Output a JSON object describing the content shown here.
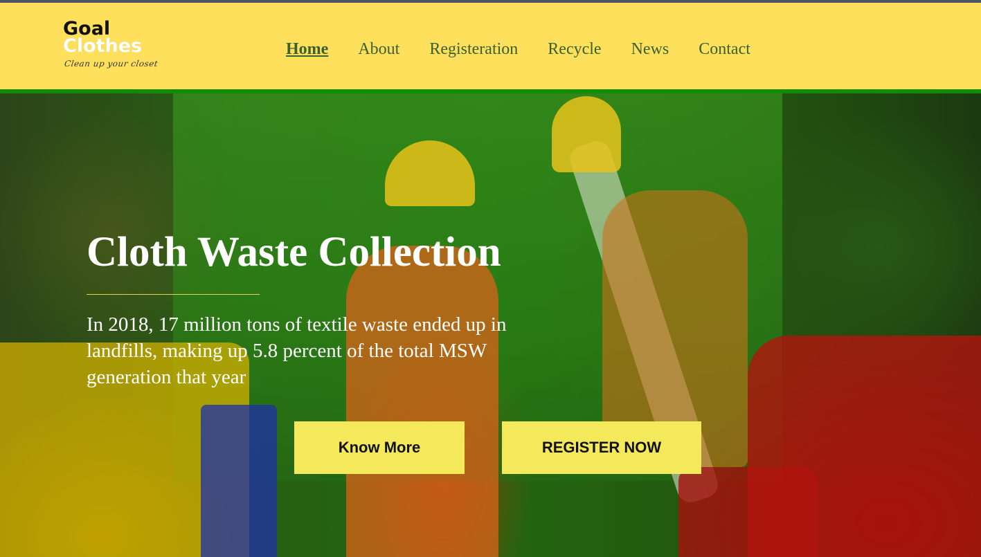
{
  "logo": {
    "line1": "Goal",
    "line2": "Clothes",
    "tagline": "Clean up your closet"
  },
  "nav": {
    "items": [
      {
        "label": "Home",
        "active": true
      },
      {
        "label": "About",
        "active": false
      },
      {
        "label": "Registeration",
        "active": false
      },
      {
        "label": "Recycle",
        "active": false
      },
      {
        "label": "News",
        "active": false
      },
      {
        "label": "Contact",
        "active": false
      }
    ]
  },
  "hero": {
    "title": "Cloth Waste Collection",
    "text": "In 2018, 17 million tons of textile waste ended up in landfills, making up 5.8 percent of the total MSW generation that year",
    "know_more_label": "Know More",
    "register_label": "REGISTER NOW"
  },
  "colors": {
    "header_bg": "#ffe05c",
    "header_border": "#118d04",
    "nav_text": "#3b6030",
    "button_bg": "#f4e85b"
  }
}
